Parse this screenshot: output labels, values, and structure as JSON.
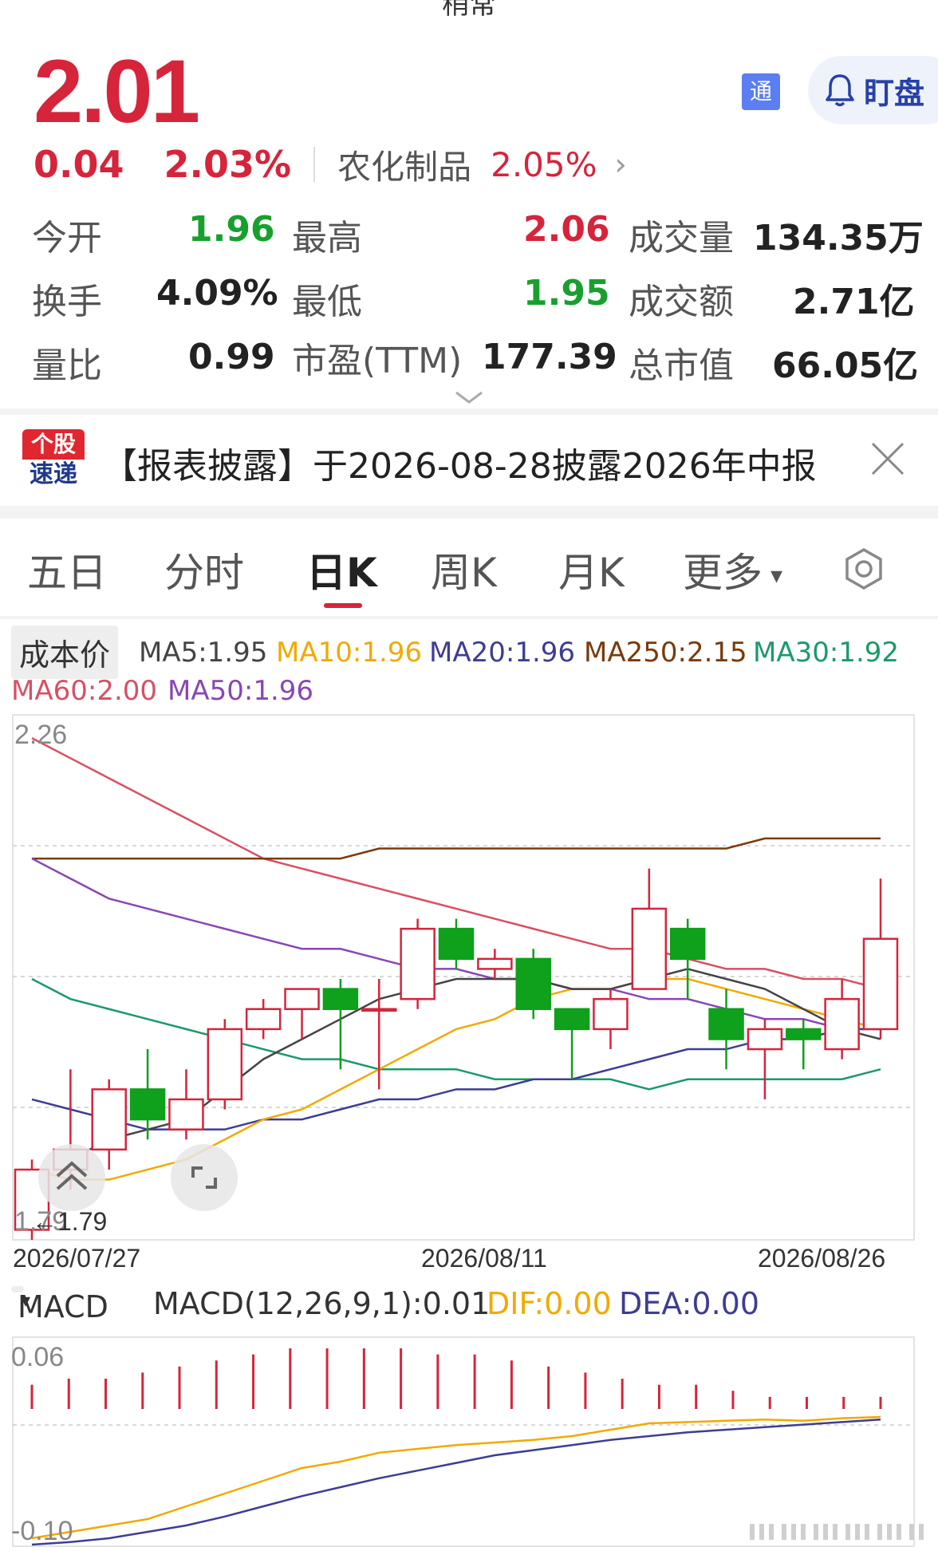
{
  "header": {
    "title_partial": "稍常",
    "price": "2.01",
    "badge_label": "通",
    "watch_label": "盯盘",
    "change": "0.04",
    "change_pct": "2.03%",
    "sector_name": "农化制品",
    "sector_pct": "2.05%",
    "sector_chevron": "›"
  },
  "stats": {
    "open_label": "今开",
    "open": "1.96",
    "high_label": "最高",
    "high": "2.06",
    "volume_label": "成交量",
    "volume": "134.35万",
    "turnover_label": "换手",
    "turnover": "4.09%",
    "low_label": "最低",
    "low": "1.95",
    "amount_label": "成交额",
    "amount": "2.71亿",
    "vol_ratio_label": "量比",
    "vol_ratio": "0.99",
    "pe_label": "市盈(TTM)",
    "pe": "177.39",
    "mcap_label": "总市值",
    "mcap": "66.05亿"
  },
  "news": {
    "logo_top": "个股",
    "logo_bottom": "速递",
    "text": "【报表披露】于2026-08-28披露2026年中报"
  },
  "tabs": [
    {
      "label": "五日"
    },
    {
      "label": "分时"
    },
    {
      "label": "日K"
    },
    {
      "label": "周K"
    },
    {
      "label": "月K"
    },
    {
      "label": "更多"
    }
  ],
  "more_caret": "▾",
  "ma_legend": {
    "cost_label": "成本价",
    "ma5": "MA5:1.95",
    "ma10": "MA10:1.96",
    "ma20": "MA20:1.96",
    "ma250": "MA250:2.15",
    "ma30": "MA30:1.92",
    "ma60": "MA60:2.00",
    "ma50": "MA50:1.96"
  },
  "colors": {
    "up": "#d6243b",
    "down": "#0fa01c",
    "ma5": "#444444",
    "ma10": "#f2a900",
    "ma20": "#3d3d95",
    "ma250": "#7a3a0a",
    "ma30": "#1a9a6a",
    "ma60": "#d94f64",
    "ma50": "#8a46b4"
  },
  "chart_data": [
    {
      "type": "candlestick",
      "y_max_label": "2.26",
      "y_min_label": "1.79",
      "min_marker": "←1.79",
      "ylim": [
        1.75,
        2.27
      ],
      "x_labels": [
        "2026/07/27",
        "2026/08/11",
        "2026/08/26"
      ],
      "candles": [
        {
          "o": 1.76,
          "h": 1.83,
          "l": 1.75,
          "c": 1.82
        },
        {
          "o": 1.82,
          "h": 1.92,
          "l": 1.8,
          "c": 1.84
        },
        {
          "o": 1.84,
          "h": 1.91,
          "l": 1.82,
          "c": 1.9
        },
        {
          "o": 1.9,
          "h": 1.94,
          "l": 1.85,
          "c": 1.87
        },
        {
          "o": 1.86,
          "h": 1.92,
          "l": 1.85,
          "c": 1.89
        },
        {
          "o": 1.89,
          "h": 1.97,
          "l": 1.88,
          "c": 1.96
        },
        {
          "o": 1.96,
          "h": 1.99,
          "l": 1.95,
          "c": 1.98
        },
        {
          "o": 1.98,
          "h": 2.0,
          "l": 1.95,
          "c": 2.0
        },
        {
          "o": 2.0,
          "h": 2.01,
          "l": 1.92,
          "c": 1.98
        },
        {
          "o": 1.98,
          "h": 2.01,
          "l": 1.9,
          "c": 1.98
        },
        {
          "o": 1.99,
          "h": 2.07,
          "l": 1.98,
          "c": 2.06
        },
        {
          "o": 2.06,
          "h": 2.07,
          "l": 2.02,
          "c": 2.03
        },
        {
          "o": 2.02,
          "h": 2.04,
          "l": 2.01,
          "c": 2.03
        },
        {
          "o": 2.03,
          "h": 2.04,
          "l": 1.97,
          "c": 1.98
        },
        {
          "o": 1.98,
          "h": 1.98,
          "l": 1.91,
          "c": 1.96
        },
        {
          "o": 1.96,
          "h": 2.0,
          "l": 1.94,
          "c": 1.99
        },
        {
          "o": 2.0,
          "h": 2.12,
          "l": 2.0,
          "c": 2.08
        },
        {
          "o": 2.06,
          "h": 2.07,
          "l": 1.99,
          "c": 2.03
        },
        {
          "o": 1.98,
          "h": 2.0,
          "l": 1.92,
          "c": 1.95
        },
        {
          "o": 1.94,
          "h": 1.97,
          "l": 1.89,
          "c": 1.96
        },
        {
          "o": 1.96,
          "h": 1.97,
          "l": 1.92,
          "c": 1.95
        },
        {
          "o": 1.94,
          "h": 2.01,
          "l": 1.93,
          "c": 1.99
        },
        {
          "o": 1.96,
          "h": 2.11,
          "l": 1.95,
          "c": 2.05
        }
      ],
      "series": [
        {
          "name": "MA60",
          "values": [
            2.25,
            2.23,
            2.21,
            2.19,
            2.17,
            2.15,
            2.13,
            2.12,
            2.11,
            2.1,
            2.09,
            2.08,
            2.07,
            2.06,
            2.05,
            2.04,
            2.04,
            2.03,
            2.02,
            2.02,
            2.01,
            2.01,
            2.0
          ]
        },
        {
          "name": "MA250",
          "values": [
            2.13,
            2.13,
            2.13,
            2.13,
            2.13,
            2.13,
            2.13,
            2.13,
            2.13,
            2.14,
            2.14,
            2.14,
            2.14,
            2.14,
            2.14,
            2.14,
            2.14,
            2.14,
            2.14,
            2.15,
            2.15,
            2.15,
            2.15
          ]
        },
        {
          "name": "MA50",
          "values": [
            2.13,
            2.11,
            2.09,
            2.08,
            2.07,
            2.06,
            2.05,
            2.04,
            2.04,
            2.03,
            2.02,
            2.02,
            2.01,
            2.01,
            2.0,
            2.0,
            1.99,
            1.99,
            1.98,
            1.97,
            1.97,
            1.96,
            1.96
          ]
        },
        {
          "name": "MA30",
          "values": [
            2.01,
            1.99,
            1.98,
            1.97,
            1.96,
            1.95,
            1.94,
            1.93,
            1.93,
            1.92,
            1.92,
            1.92,
            1.91,
            1.91,
            1.91,
            1.91,
            1.9,
            1.91,
            1.91,
            1.91,
            1.91,
            1.91,
            1.92
          ]
        },
        {
          "name": "MA20",
          "values": [
            1.89,
            1.88,
            1.87,
            1.86,
            1.86,
            1.86,
            1.87,
            1.87,
            1.88,
            1.89,
            1.89,
            1.9,
            1.9,
            1.91,
            1.91,
            1.92,
            1.93,
            1.94,
            1.94,
            1.95,
            1.95,
            1.96,
            1.96
          ]
        },
        {
          "name": "MA10",
          "values": [
            1.82,
            1.81,
            1.81,
            1.82,
            1.83,
            1.85,
            1.87,
            1.88,
            1.9,
            1.92,
            1.94,
            1.96,
            1.97,
            1.99,
            2.0,
            2.0,
            2.01,
            2.01,
            2.0,
            1.99,
            1.98,
            1.97,
            1.96
          ]
        },
        {
          "name": "MA5",
          "values": [
            1.82,
            1.83,
            1.85,
            1.86,
            1.87,
            1.9,
            1.93,
            1.95,
            1.97,
            1.99,
            2.0,
            2.01,
            2.01,
            2.01,
            2.0,
            2.0,
            2.01,
            2.02,
            2.01,
            2.0,
            1.98,
            1.96,
            1.95
          ]
        }
      ]
    },
    {
      "type": "bar",
      "name": "MACD",
      "selector_label": "MACD",
      "params": "MACD(12,26,9,1):0.01",
      "dif_label": "DIF:0.00",
      "dea_label": "DEA:0.00",
      "y_max_label": "0.06",
      "y_min_label": "-0.10",
      "ylim": [
        -0.1,
        0.06
      ],
      "histogram": [
        0.02,
        0.025,
        0.025,
        0.03,
        0.035,
        0.04,
        0.045,
        0.05,
        0.05,
        0.05,
        0.05,
        0.045,
        0.045,
        0.04,
        0.035,
        0.03,
        0.025,
        0.02,
        0.02,
        0.015,
        0.01,
        0.01,
        0.01,
        0.01
      ],
      "series": [
        {
          "name": "DIF",
          "values": [
            -0.095,
            -0.09,
            -0.085,
            -0.08,
            -0.07,
            -0.06,
            -0.05,
            -0.04,
            -0.035,
            -0.028,
            -0.025,
            -0.022,
            -0.02,
            -0.018,
            -0.015,
            -0.01,
            -0.005,
            -0.004,
            -0.003,
            -0.002,
            -0.003,
            -0.001,
            0.0
          ]
        },
        {
          "name": "DEA",
          "values": [
            -0.1,
            -0.098,
            -0.095,
            -0.09,
            -0.085,
            -0.078,
            -0.07,
            -0.062,
            -0.055,
            -0.048,
            -0.042,
            -0.036,
            -0.03,
            -0.026,
            -0.022,
            -0.018,
            -0.015,
            -0.012,
            -0.01,
            -0.008,
            -0.006,
            -0.004,
            -0.002
          ]
        }
      ]
    }
  ]
}
